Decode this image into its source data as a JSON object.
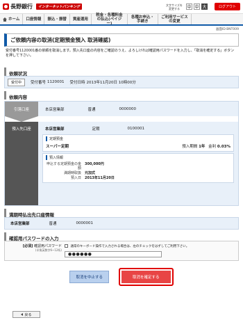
{
  "header": {
    "bank_name": "長野銀行",
    "service_badge": "インターネットバンキング",
    "font_size_label": "文字サイズを変更する",
    "font_sizes": [
      "中",
      "中",
      "大"
    ],
    "logout": "ログアウト"
  },
  "nav": {
    "items": [
      "ホーム",
      "口座情報",
      "振込・振替",
      "資産運用",
      "税金・各種料金の払込(ペイジー)",
      "各種お申込・手続き",
      "ご利用サービスの変更"
    ]
  },
  "screen_id": "画面ID:BNT009",
  "page": {
    "title": "ご依頼内容の取消(定期預金預入 取消確認)",
    "description": "受付番号1120001番の依頼を取消します。預入先口座の内容をご確認のうえ、よろしければ確認用パスワードを入力し、「取消を確定する」ボタンを押して下さい。"
  },
  "status_section": {
    "title": "依頼状況",
    "badge": "受付中",
    "receipt_label": "受付番号",
    "receipt_no": "1120001",
    "date_label": "受付日時",
    "date_value": "2013年11月20日 10時00分"
  },
  "content_section": {
    "title": "依頼内容",
    "from": {
      "label": "引落口座",
      "branch": "本店営業部",
      "type": "普通",
      "account": "0000000"
    },
    "to": {
      "label": "預入先口座",
      "branch": "本店営業部",
      "type": "定期",
      "account": "0100001",
      "deposit": {
        "head": "定期預金",
        "name": "スーパー定期",
        "term_label": "預入期間",
        "term": "1年",
        "rate_label": "金利",
        "rate": "0.03%"
      },
      "info": {
        "head": "預入情報",
        "amount_label": "申込する定期預金の金額",
        "amount": "300,000円",
        "maturity_label": "満期時取扱",
        "maturity": "元加式",
        "date_label": "預入日",
        "date": "2013年11月20日"
      }
    }
  },
  "maturity_section": {
    "title": "満期時払出先口座情報",
    "branch": "本店営業部",
    "type": "普通",
    "account": "0000001"
  },
  "password_section": {
    "title": "確認用パスワードの入力",
    "required": "[必須]",
    "label": "確認用パスワード",
    "sub_label": "(半角英数字6~12桁)",
    "note": "通常のキーボード操作で入力される場合は、左のチェックをはずしてご利用下さい。",
    "masked_value": "●●●●●●"
  },
  "actions": {
    "stop": "取消を中止する",
    "confirm": "取消を確定する"
  },
  "back": "戻る",
  "colors": {
    "brand_red": "#d40000",
    "accent_blue": "#0f5aa8",
    "confirm_red": "#e84545"
  }
}
